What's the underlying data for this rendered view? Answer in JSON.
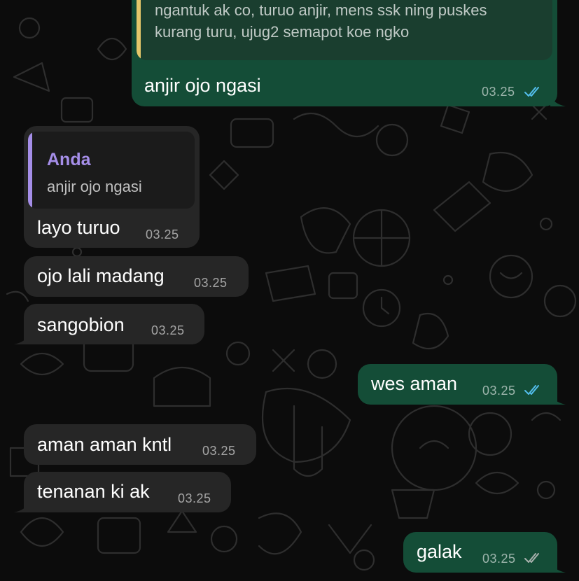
{
  "colors": {
    "outgoing_bubble": "#144d37",
    "incoming_bubble": "#262626",
    "read_ticks": "#53bdeb",
    "delivered_ticks": "#a8b1ad",
    "quote_bar_self": "#e6c76a",
    "quote_bar_author": "#a58ee8"
  },
  "messages": [
    {
      "direction": "outgoing",
      "quote": {
        "lines": [
          "ngantuk ak co, turuo anjir, mens ssk ning puskes",
          "kurang turu, ujug2 semapot koe ngko"
        ]
      },
      "text": "anjir ojo ngasi",
      "time": "03.25",
      "status_icon": "double-check-icon",
      "status": "read"
    },
    {
      "direction": "incoming",
      "quote": {
        "author": "Anda",
        "text": "anjir ojo ngasi"
      },
      "text": "layo turuo",
      "time": "03.25"
    },
    {
      "direction": "incoming",
      "text": "ojo lali madang",
      "time": "03.25"
    },
    {
      "direction": "incoming",
      "text": "sangobion",
      "time": "03.25"
    },
    {
      "direction": "outgoing",
      "text": "wes aman",
      "time": "03.25",
      "status_icon": "double-check-icon",
      "status": "read"
    },
    {
      "direction": "incoming",
      "text": "aman aman kntl",
      "time": "03.25"
    },
    {
      "direction": "incoming",
      "text": "tenanan ki ak",
      "time": "03.25"
    },
    {
      "direction": "outgoing",
      "text": "galak",
      "time": "03.25",
      "status_icon": "double-check-icon",
      "status": "delivered"
    }
  ]
}
